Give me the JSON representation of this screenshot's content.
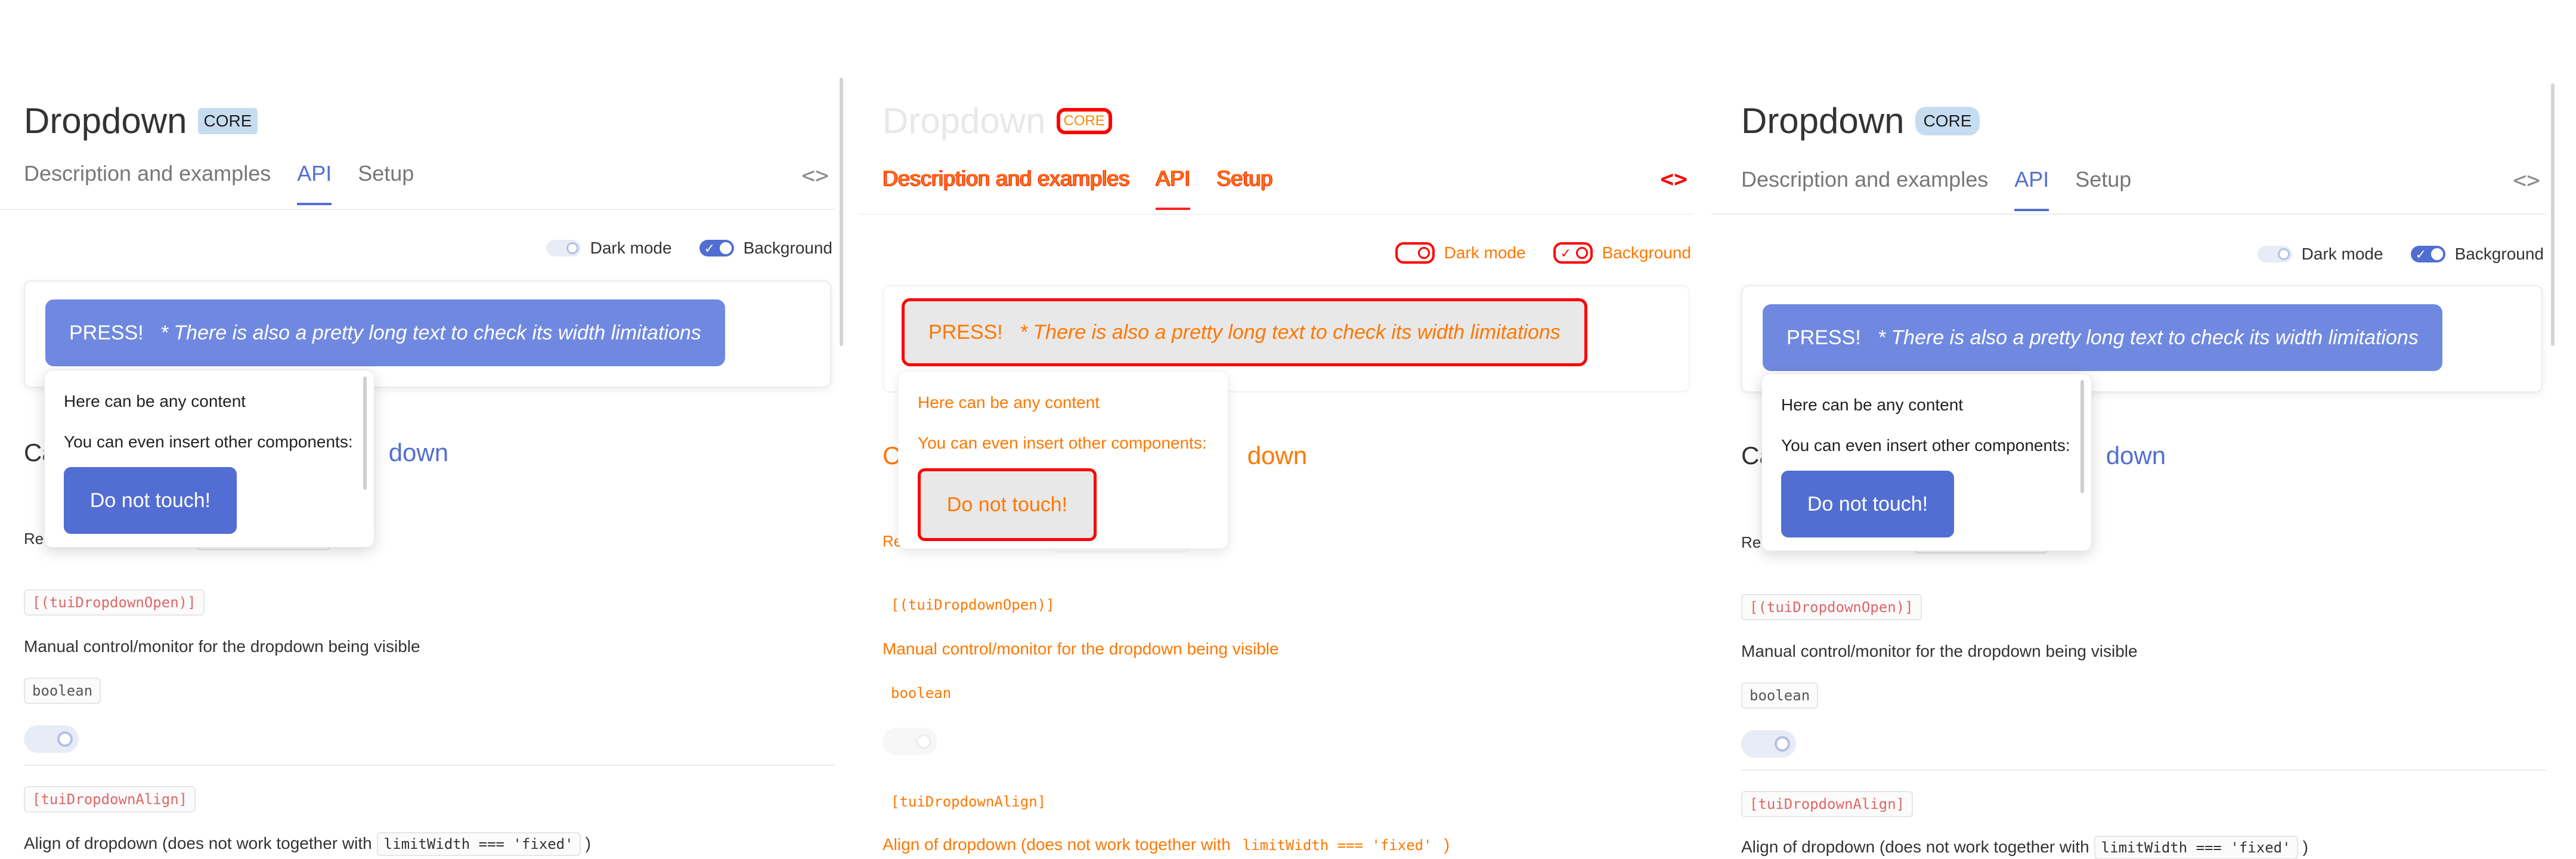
{
  "page": {
    "title": "Dropdown",
    "badge": "CORE",
    "tabs": [
      "Description and examples",
      "API",
      "Setup"
    ],
    "code_icon": "code-brackets-icon",
    "toggles": {
      "dark_mode_label": "Dark mode",
      "dark_mode_on": false,
      "background_label": "Background",
      "background_on": true
    },
    "press_button": {
      "label": "PRESS!",
      "note": "* There is also a pretty long text to check its width limitations"
    },
    "dropdown_content": {
      "line1": "Here can be any content",
      "line2": "You can even insert other components:",
      "button": "Do not touch!"
    },
    "section": {
      "prefix": "Ca",
      "suffix": "down"
    },
    "req_prefix": "Re",
    "api": [
      {
        "name": "[(tuiDropdownOpen)]",
        "description": "Manual control/monitor for the dropdown being visible",
        "type": "boolean"
      },
      {
        "name": "[tuiDropdownAlign]",
        "description_before": "Align of dropdown (does not work together with",
        "description_code": "limitWidth === 'fixed'",
        "description_after": ")"
      }
    ]
  },
  "colors": {
    "accent": "#526ed3",
    "press_bg": "#7089e0",
    "badge_bg": "#c6dcf0",
    "diff_red": "#ff0000",
    "diff_orange": "#ff7700"
  }
}
